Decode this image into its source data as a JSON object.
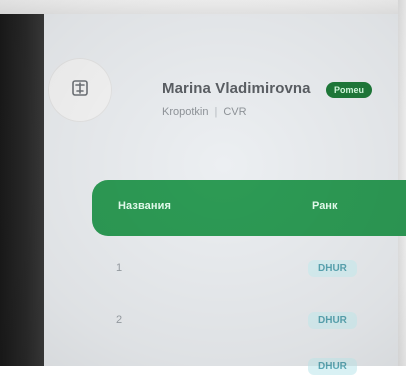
{
  "profile": {
    "name": "Marina Vladimirovna",
    "badge": "Pomeu",
    "city": "Kropotkin",
    "separator": "|",
    "group": "CVR"
  },
  "table": {
    "headers": {
      "name": "Названия",
      "rank": "Ранк"
    },
    "rows": [
      {
        "index": "1",
        "status": "DHUR"
      },
      {
        "index": "2",
        "status": "DHUR"
      },
      {
        "index": "",
        "status": "DHUR"
      }
    ]
  },
  "colors": {
    "accent": "#2d9b55",
    "badge": "#1f7a3a",
    "pill_bg": "#d9f1f4",
    "pill_text": "#5aa6b3"
  },
  "icons": {
    "avatar": "profile-pattern-icon"
  }
}
